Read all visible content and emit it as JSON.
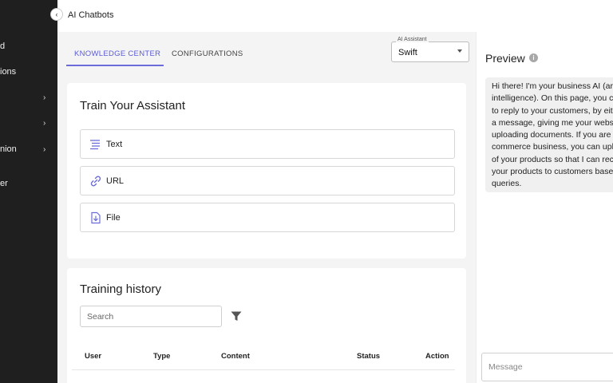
{
  "sidebar": {
    "items": [
      {
        "label": "d",
        "has_chevron": false
      },
      {
        "label": "ions",
        "has_chevron": false
      },
      {
        "label": "",
        "has_chevron": true
      },
      {
        "label": "",
        "has_chevron": true
      },
      {
        "label": "nion",
        "has_chevron": true
      },
      {
        "label": "er",
        "has_chevron": false
      }
    ],
    "collapse_icon": "chevron-left-icon"
  },
  "header": {
    "title": "AI Chatbots"
  },
  "tabs": [
    {
      "label": "KNOWLEDGE CENTER",
      "active": true
    },
    {
      "label": "CONFIGURATIONS",
      "active": false
    }
  ],
  "assistant_select": {
    "legend": "AI Assistant",
    "value": "Swift"
  },
  "train": {
    "title": "Train Your Assistant",
    "options": [
      {
        "label": "Text",
        "icon": "text-lines-icon"
      },
      {
        "label": "URL",
        "icon": "link-icon"
      },
      {
        "label": "File",
        "icon": "file-download-icon"
      }
    ]
  },
  "history": {
    "title": "Training history",
    "search_placeholder": "Search",
    "filter_icon": "filter-icon",
    "columns": [
      "User",
      "Type",
      "Content",
      "Status",
      "Action"
    ]
  },
  "preview": {
    "title": "Preview",
    "info_icon": "info-icon",
    "message_lines": [
      "Hi there! I'm your business AI (ar",
      "intelligence). On this page, you c",
      "to reply to your customers, by eit",
      "a message, giving me your websi",
      "uploading documents. If you are",
      "commerce business, you can upl",
      "of your products so that I can rec",
      "your products to customers base",
      "queries."
    ],
    "input_placeholder": "Message"
  },
  "colors": {
    "accent": "#5b5bd6",
    "sidebar_bg": "#1f1f1f",
    "main_bg": "#f4f4f5"
  }
}
